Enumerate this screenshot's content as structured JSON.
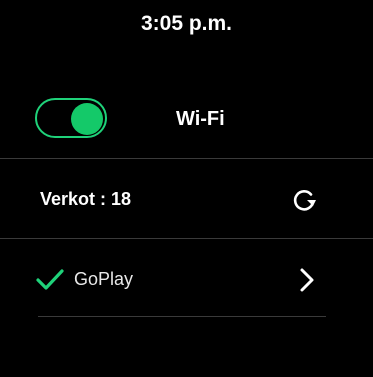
{
  "status_bar": {
    "time": "3:05 p.m."
  },
  "wifi": {
    "label": "Wi-Fi",
    "enabled": true,
    "accent_color": "#14c969"
  },
  "networks": {
    "label": "Verkot : 18",
    "refresh_icon": "refresh-icon"
  },
  "network_list": [
    {
      "name": "GoPlay",
      "connected": true,
      "status_icon": "checkmark-icon",
      "action_icon": "chevron-right-icon"
    }
  ]
}
